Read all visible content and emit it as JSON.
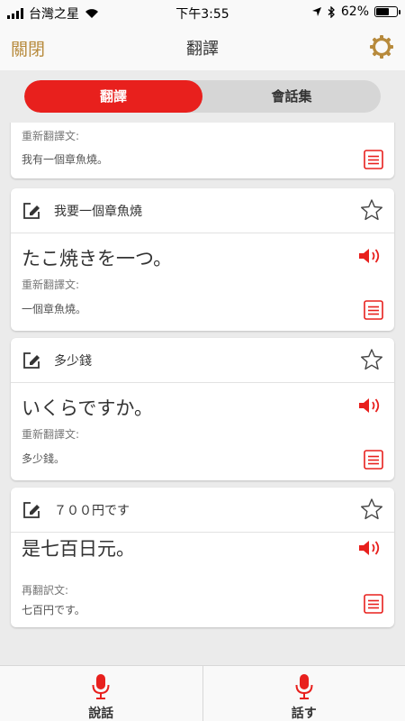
{
  "status_bar": {
    "carrier": "台灣之星",
    "time": "下午3:55",
    "battery": "62%",
    "battery_level": 0.62
  },
  "nav": {
    "close_label": "關閉",
    "title": "翻譯"
  },
  "tabs": [
    {
      "label": "翻譯",
      "active": true
    },
    {
      "label": "會話集",
      "active": false
    }
  ],
  "cards": [
    {
      "retranslation_label": "重新翻譯文:",
      "retranslation": "我有一個章魚燒。"
    },
    {
      "source": "我要一個章魚燒",
      "translation": "たこ焼きを一つ。",
      "retranslation_label": "重新翻譯文:",
      "retranslation": "一個章魚燒。"
    },
    {
      "source": "多少錢",
      "translation": "いくらですか。",
      "retranslation_label": "重新翻譯文:",
      "retranslation": "多少錢。"
    },
    {
      "source": "７００円です",
      "translation": "是七百日元。",
      "retranslation_label": "再翻訳文:",
      "retranslation": "七百円です。"
    }
  ],
  "bottom": {
    "left_label": "說話",
    "right_label": "話す"
  },
  "colors": {
    "accent_red": "#e8201d",
    "close_gold": "#b78a3c"
  }
}
